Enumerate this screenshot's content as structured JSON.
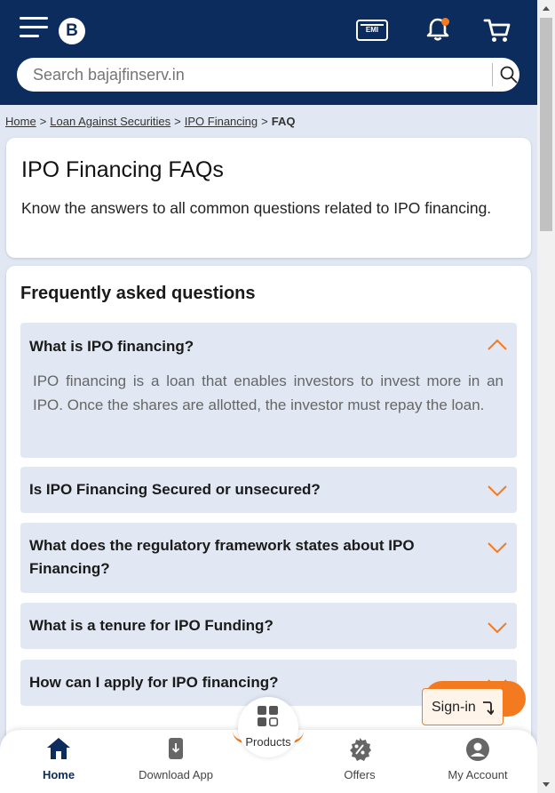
{
  "header": {
    "logo_text": "B",
    "emi_label": "EMI",
    "search": {
      "placeholder": "Search bajajfinserv.in",
      "value": ""
    },
    "brand_color": "#0b2c5c",
    "accent_color": "#f47a20"
  },
  "breadcrumb": {
    "items": [
      "Home",
      "Loan Against Securities",
      "IPO Financing"
    ],
    "separator": ">",
    "current": "FAQ"
  },
  "intro": {
    "title": "IPO Financing FAQs",
    "description": "Know the answers to all common questions related to IPO financing."
  },
  "faq": {
    "heading": "Frequently asked questions",
    "items": [
      {
        "question": "What is IPO financing?",
        "answer": "IPO financing is a loan that enables investors to invest more in an IPO. Once the shares are allotted, the investor must repay the loan.",
        "expanded": true
      },
      {
        "question": "Is IPO Financing Secured or unsecured?",
        "expanded": false
      },
      {
        "question": "What does the regulatory framework states about IPO Financing?",
        "expanded": false
      },
      {
        "question": "What is a tenure for IPO Funding?",
        "expanded": false
      },
      {
        "question": "How can I apply for IPO financing?",
        "expanded": false
      }
    ]
  },
  "signin": {
    "label": "Sign-in"
  },
  "bottom_nav": {
    "home": "Home",
    "download_app": "Download App",
    "products": "Products",
    "offers": "Offers",
    "my_account": "My Account"
  }
}
